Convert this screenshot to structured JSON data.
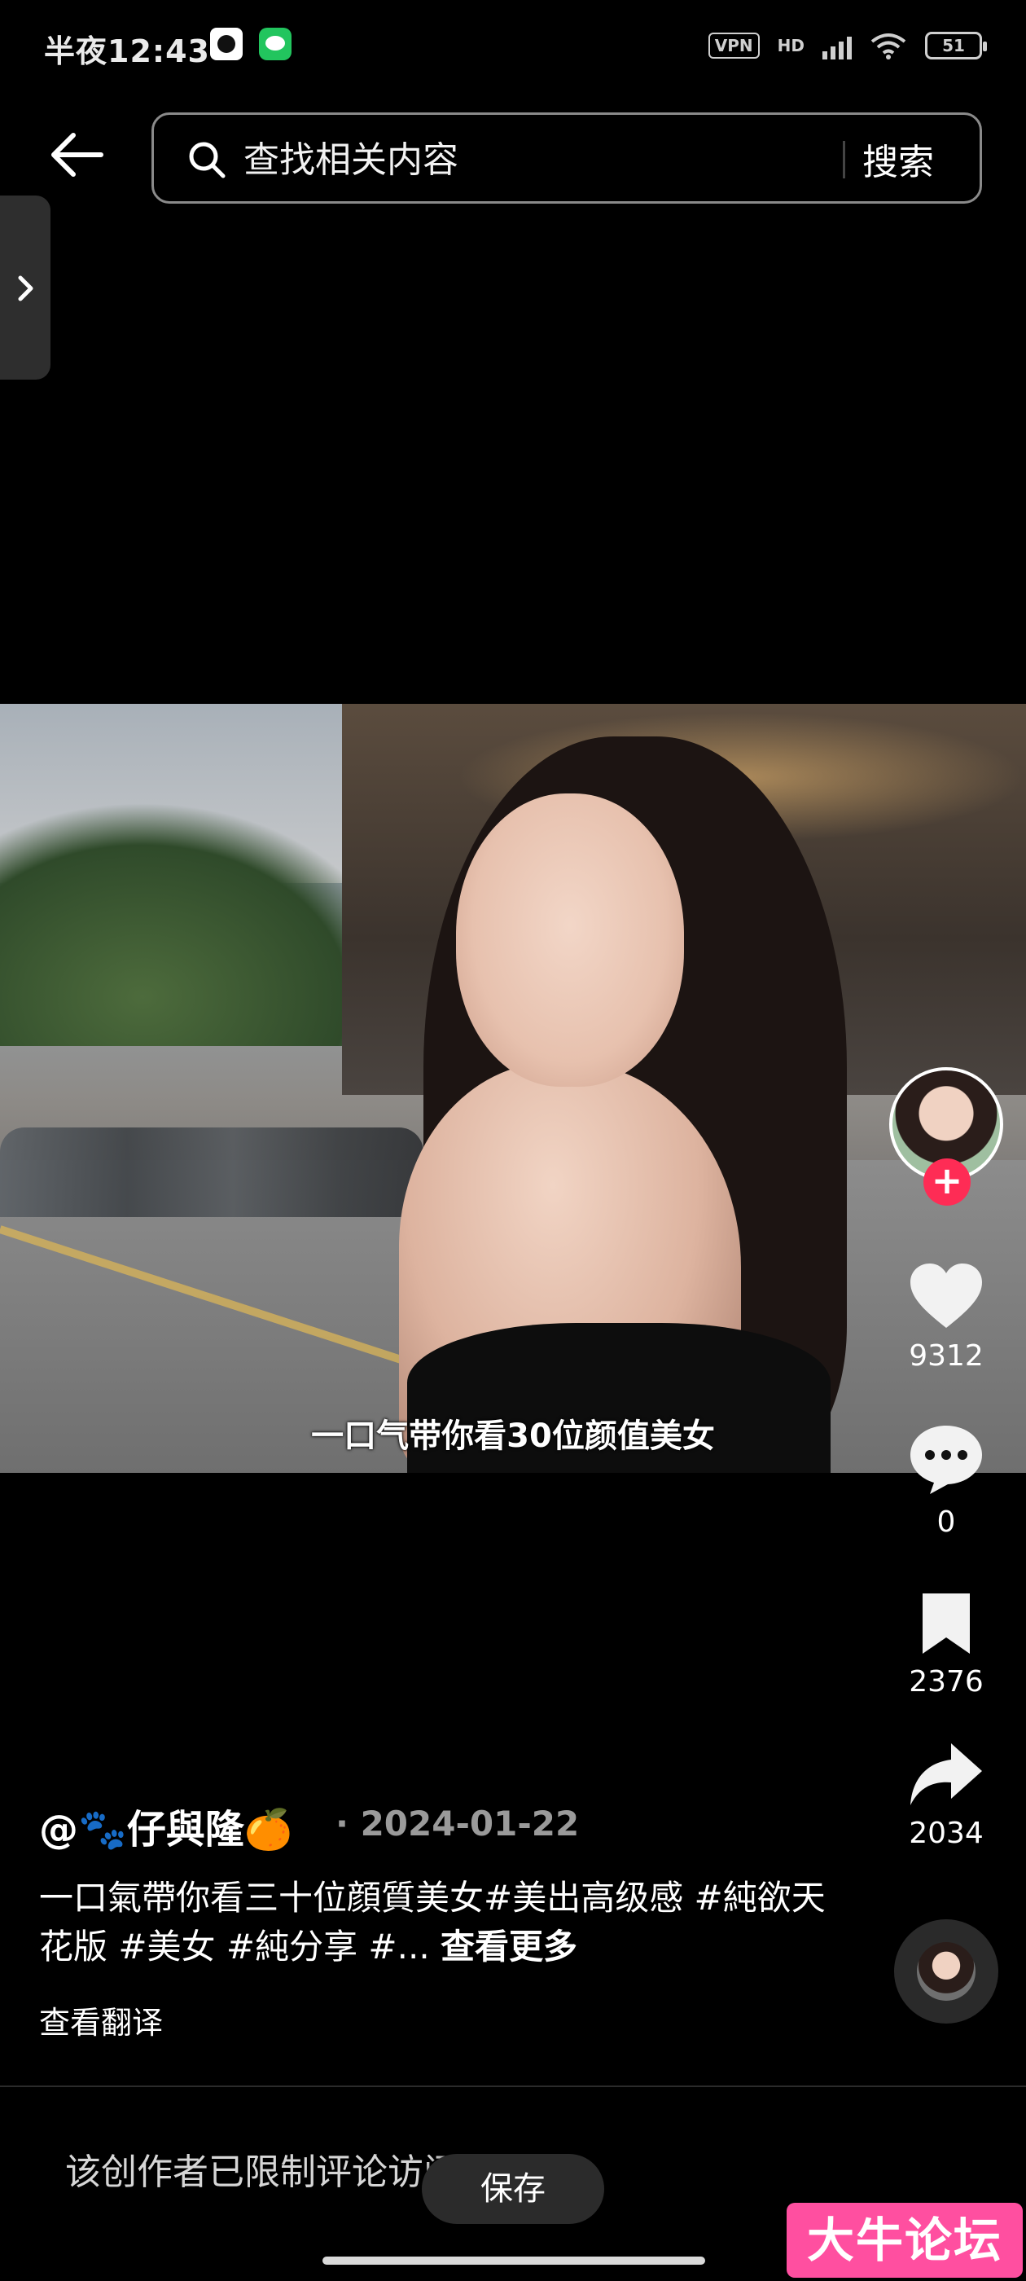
{
  "status_bar": {
    "time": "半夜12:43",
    "vpn_label": "VPN",
    "network_label": "HD",
    "battery_level": "51"
  },
  "search": {
    "placeholder": "查找相关内容",
    "button_label": "搜索"
  },
  "video": {
    "subtitle": "一口气带你看30位颜值美女"
  },
  "actions": {
    "follow_label": "+",
    "like_count": "9312",
    "comment_count": "0",
    "favorite_count": "2376",
    "share_count": "2034"
  },
  "caption": {
    "author": "@🐾仔與隆🍊",
    "date": "· 2024-01-22",
    "text": "一口氣帶你看三十位顔質美女#美出高级感 #純欲天花版 #美女 #純分享 #...",
    "see_more": "查看更多",
    "translate": "查看翻译"
  },
  "footer": {
    "comments_restricted": "该创作者已限制评论访问",
    "save_label": "保存"
  },
  "watermark": {
    "text": "大牛论坛"
  },
  "colors": {
    "accent": "#fe2c55",
    "background": "#000000",
    "watermark_bg": "#ff4fa0"
  },
  "icons": [
    "back-arrow-icon",
    "search-icon",
    "chevron-right-icon",
    "heart-icon",
    "comment-icon",
    "bookmark-icon",
    "share-icon"
  ]
}
